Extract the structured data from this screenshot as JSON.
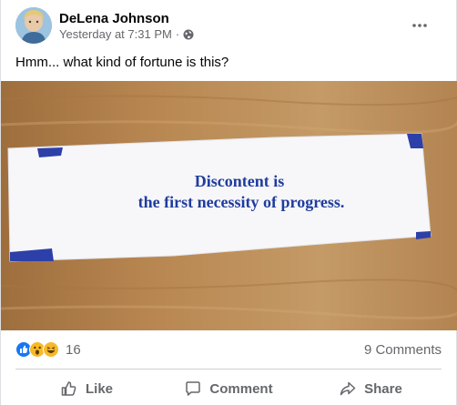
{
  "post": {
    "author": "DeLena Johnson",
    "timestamp": "Yesterday at 7:31 PM",
    "separator": "·",
    "audience_icon": "globe-icon",
    "caption": "Hmm... what kind of fortune is this?",
    "image": {
      "fortune_line1": "Discontent is",
      "fortune_line2": "the first necessity of progress."
    },
    "reactions": {
      "icons": [
        "like-icon",
        "wow-icon",
        "haha-icon"
      ],
      "count": "16"
    },
    "comments_label": "9 Comments",
    "actions": {
      "like": "Like",
      "comment": "Comment",
      "share": "Share"
    }
  },
  "colors": {
    "like_blue": "#1877f2",
    "reaction_yellow": "#f7b928",
    "secondary_text": "#65676b",
    "fortune_ink": "#1f3c9e"
  }
}
